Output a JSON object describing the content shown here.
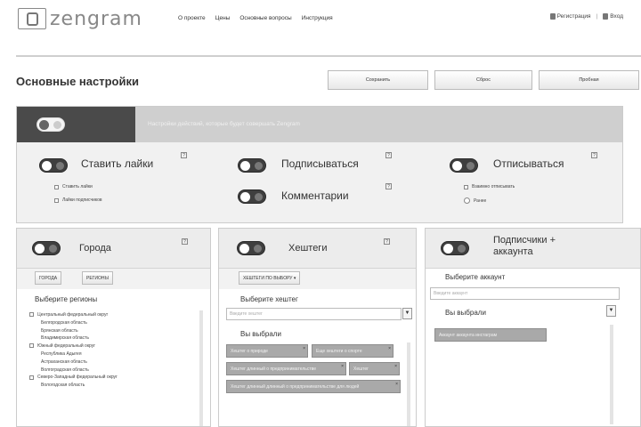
{
  "header": {
    "logo_text": "zengram",
    "nav": [
      "О проекте",
      "Цены",
      "Основные вопросы",
      "Инструкция"
    ],
    "register": "Регистрация",
    "login": "Вход"
  },
  "page": {
    "title": "Основные настройки",
    "buttons": [
      "Сохранить",
      "Сброс",
      "Пробная"
    ]
  },
  "main_panel": {
    "bar_text": "Настройки действий, которые будет совершать Zengram",
    "actions": {
      "likes": "Ставить лайки",
      "follow": "Подписываться",
      "unfollow": "Отписываться",
      "comments": "Комментарии"
    },
    "likes_options": [
      "Ставить лайки",
      "Лайки подписчиков"
    ],
    "unfollow_options": [
      "Взаимно отписывать",
      "Ранее"
    ],
    "help": "?"
  },
  "cities_panel": {
    "title": "Города",
    "tabs": [
      "ГОРОДА",
      "РЕГИОНЫ"
    ],
    "select_label": "Выберите регионы",
    "tree": [
      {
        "label": "Центральный федеральный округ",
        "level": 1
      },
      {
        "label": "Белгородская область",
        "level": 2
      },
      {
        "label": "Брянская область",
        "level": 2
      },
      {
        "label": "Владимирская область",
        "level": 2
      },
      {
        "label": "Южный федеральный округ",
        "level": 1
      },
      {
        "label": "Республика Адыгея",
        "level": 2
      },
      {
        "label": "Астраханская область",
        "level": 2
      },
      {
        "label": "Волгоградская область",
        "level": 2
      },
      {
        "label": "Северо-Западный федеральный округ",
        "level": 1
      },
      {
        "label": "Вологодская область",
        "level": 2
      }
    ]
  },
  "hashtags_panel": {
    "title": "Хештеги",
    "dropdown_button": "ХЕШТЕГИ ПО ВЫБОРУ ▾",
    "select_label": "Выберите хештег",
    "input_placeholder": "Введите хештег",
    "selected_label": "Вы выбрали",
    "chips": [
      "Хештег о природе",
      "Еще хештеги о спорте",
      "Хештег длинный о предпринимательстве",
      "Хештег",
      "Хештег длинный длинный о предпринимательстве для людей"
    ]
  },
  "accounts_panel": {
    "title_line1": "Подписчики +",
    "title_line2": "аккаунта",
    "select_label": "Выберите аккаунт",
    "input_placeholder": "Введите аккаунт",
    "selected_label": "Вы выбрали",
    "chips": [
      "Аккаунт аккаунта инстаграм"
    ]
  },
  "colors": {
    "dark": "#4a4a4a",
    "panel": "#f1f1f1",
    "accent_bar": "#cfcfcf"
  }
}
